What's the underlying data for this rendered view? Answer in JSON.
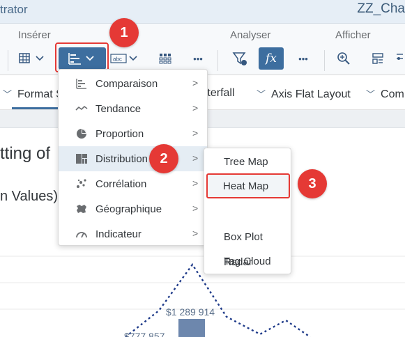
{
  "titlebar": {
    "app_title": "trator",
    "doc_title": "ZZ_Cha"
  },
  "toolbar": {
    "group_insert": "Insérer",
    "group_analyze": "Analyser",
    "group_display": "Afficher",
    "more_label": "•••",
    "fx_label": "fx",
    "text_btn_label": "abc"
  },
  "tabs": [
    {
      "label": "Format S"
    },
    {
      "label": "Waterfall"
    },
    {
      "label": "Axis Flat Layout"
    },
    {
      "label": "Com"
    }
  ],
  "canvas": {
    "heading_partial": "tting of",
    "subheading_partial": "n Values)",
    "value_label_1": "$1 289 914",
    "value_label_2": "$777 857"
  },
  "menu": {
    "items": [
      {
        "label": "Comparaison",
        "icon": "bar-chart-icon",
        "arrow": ">"
      },
      {
        "label": "Tendance",
        "icon": "trend-line-icon",
        "arrow": ">"
      },
      {
        "label": "Proportion",
        "icon": "pie-chart-icon",
        "arrow": ">"
      },
      {
        "label": "Distribution",
        "icon": "treemap-icon",
        "arrow": ">"
      },
      {
        "label": "Corrélation",
        "icon": "scatter-icon",
        "arrow": ">"
      },
      {
        "label": "Géographique",
        "icon": "map-icon",
        "arrow": ">"
      },
      {
        "label": "Indicateur",
        "icon": "gauge-icon",
        "arrow": ">"
      }
    ],
    "active_index": 3
  },
  "submenu": {
    "items": [
      {
        "label": "Tree Map"
      },
      {
        "label": "Heat Map"
      },
      {
        "label": "Box Plot"
      },
      {
        "label": "Radar"
      },
      {
        "label": "Tag Cloud"
      }
    ],
    "highlight_index": 1
  },
  "badges": {
    "step1": "1",
    "step2": "2",
    "step3": "3"
  },
  "colors": {
    "accent": "#3d6e9f",
    "badge": "#e53935",
    "series": "#1f3b8a"
  }
}
